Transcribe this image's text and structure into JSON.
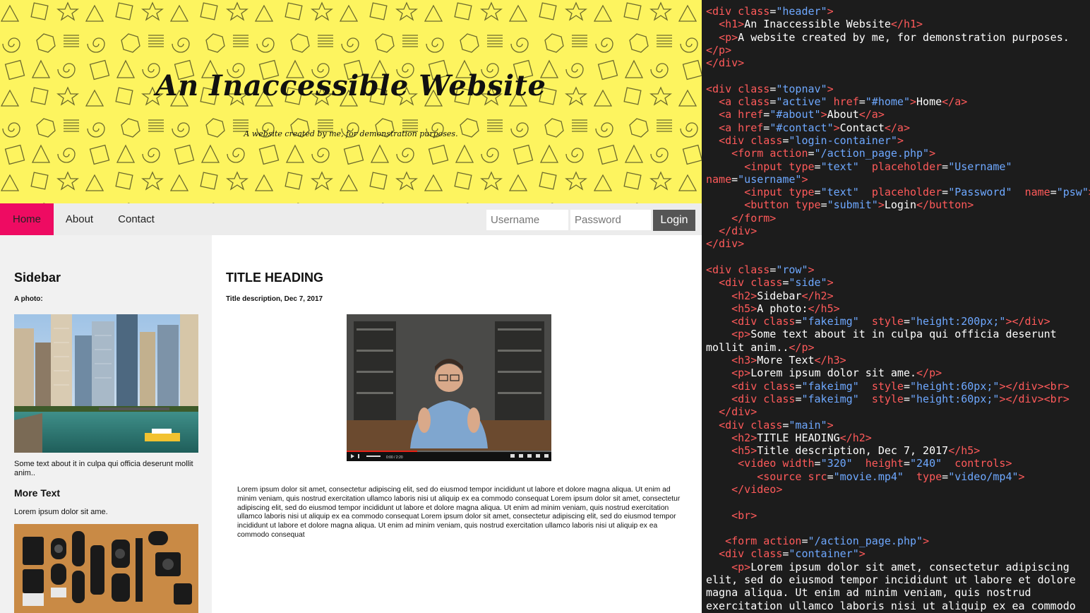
{
  "header": {
    "title": "An Inaccessible Website",
    "subtitle": "A website created by me, for demonstration purposes."
  },
  "topnav": {
    "home": "Home",
    "about": "About",
    "contact": "Contact",
    "username_placeholder": "Username",
    "password_placeholder": "Password",
    "login": "Login",
    "active_color": "#ee0b62"
  },
  "sidebar": {
    "heading": "Sidebar",
    "photo_label": "A photo:",
    "photo_text": "Some text about it in culpa qui officia deserunt mollit anim..",
    "more_heading": "More Text",
    "more_text": "Lorem ipsum dolor sit ame."
  },
  "main": {
    "heading": "TITLE HEADING",
    "description": "Title description, Dec 7, 2017",
    "video_time": "0:00 / 2:20",
    "body": "Lorem ipsum dolor sit amet, consectetur adipiscing elit, sed do eiusmod tempor incididunt ut labore et dolore magna aliqua. Ut enim ad minim veniam, quis nostrud exercitation ullamco laboris nisi ut aliquip ex ea commodo consequat Lorem ipsum dolor sit amet, consectetur adipiscing elit, sed do eiusmod tempor incididunt ut labore et dolore magna aliqua. Ut enim ad minim veniam, quis nostrud exercitation ullamco laboris nisi ut aliquip ex ea commodo consequat Lorem ipsum dolor sit amet, consectetur adipiscing elit, sed do eiusmod tempor incididunt ut labore et dolore magna aliqua. Ut enim ad minim veniam, quis nostrud exercitation ullamco laboris nisi ut aliquip ex ea commodo consequat"
  },
  "colors": {
    "header_bg": "#fdf45f",
    "code_bg": "#1c1c1c",
    "code_tag": "#ff5a5a",
    "code_value": "#6ea8ff"
  },
  "code_lines": [
    [
      [
        "t",
        "<div "
      ],
      [
        "a",
        "class"
      ],
      [
        "w",
        "="
      ],
      [
        "v",
        "\"header\""
      ],
      [
        "t",
        ">"
      ]
    ],
    [
      [
        "w",
        "  "
      ],
      [
        "t",
        "<h1>"
      ],
      [
        "w",
        "An Inaccessible Website"
      ],
      [
        "t",
        "</h1>"
      ]
    ],
    [
      [
        "w",
        "  "
      ],
      [
        "t",
        "<p>"
      ],
      [
        "w",
        "A website created by me, for demonstration purposes."
      ]
    ],
    [
      [
        "t",
        "</p>"
      ]
    ],
    [
      [
        "t",
        "</div>"
      ]
    ],
    [
      [
        "w",
        ""
      ]
    ],
    [
      [
        "t",
        "<div "
      ],
      [
        "a",
        "class"
      ],
      [
        "w",
        "="
      ],
      [
        "v",
        "\"topnav\""
      ],
      [
        "t",
        ">"
      ]
    ],
    [
      [
        "w",
        "  "
      ],
      [
        "t",
        "<a "
      ],
      [
        "a",
        "class"
      ],
      [
        "w",
        "="
      ],
      [
        "v",
        "\"active\""
      ],
      [
        "w",
        " "
      ],
      [
        "a",
        "href"
      ],
      [
        "w",
        "="
      ],
      [
        "v",
        "\"#home\""
      ],
      [
        "t",
        ">"
      ],
      [
        "w",
        "Home"
      ],
      [
        "t",
        "</a>"
      ]
    ],
    [
      [
        "w",
        "  "
      ],
      [
        "t",
        "<a "
      ],
      [
        "a",
        "href"
      ],
      [
        "w",
        "="
      ],
      [
        "v",
        "\"#about\""
      ],
      [
        "t",
        ">"
      ],
      [
        "w",
        "About"
      ],
      [
        "t",
        "</a>"
      ]
    ],
    [
      [
        "w",
        "  "
      ],
      [
        "t",
        "<a "
      ],
      [
        "a",
        "href"
      ],
      [
        "w",
        "="
      ],
      [
        "v",
        "\"#contact\""
      ],
      [
        "t",
        ">"
      ],
      [
        "w",
        "Contact"
      ],
      [
        "t",
        "</a>"
      ]
    ],
    [
      [
        "w",
        "  "
      ],
      [
        "t",
        "<div "
      ],
      [
        "a",
        "class"
      ],
      [
        "w",
        "="
      ],
      [
        "v",
        "\"login-container\""
      ],
      [
        "t",
        ">"
      ]
    ],
    [
      [
        "w",
        "    "
      ],
      [
        "t",
        "<form "
      ],
      [
        "a",
        "action"
      ],
      [
        "w",
        "="
      ],
      [
        "v",
        "\"/action_page.php\""
      ],
      [
        "t",
        ">"
      ]
    ],
    [
      [
        "w",
        "      "
      ],
      [
        "t",
        "<input "
      ],
      [
        "a",
        "type"
      ],
      [
        "w",
        "="
      ],
      [
        "v",
        "\"text\""
      ],
      [
        "w",
        "  "
      ],
      [
        "a",
        "placeholder"
      ],
      [
        "w",
        "="
      ],
      [
        "v",
        "\"Username\""
      ]
    ],
    [
      [
        "a",
        "name"
      ],
      [
        "w",
        "="
      ],
      [
        "v",
        "\"username\""
      ],
      [
        "t",
        ">"
      ]
    ],
    [
      [
        "w",
        "      "
      ],
      [
        "t",
        "<input "
      ],
      [
        "a",
        "type"
      ],
      [
        "w",
        "="
      ],
      [
        "v",
        "\"text\""
      ],
      [
        "w",
        "  "
      ],
      [
        "a",
        "placeholder"
      ],
      [
        "w",
        "="
      ],
      [
        "v",
        "\"Password\""
      ],
      [
        "w",
        "  "
      ],
      [
        "a",
        "name"
      ],
      [
        "w",
        "="
      ],
      [
        "v",
        "\"psw\""
      ],
      [
        "t",
        ">"
      ]
    ],
    [
      [
        "w",
        "      "
      ],
      [
        "t",
        "<button "
      ],
      [
        "a",
        "type"
      ],
      [
        "w",
        "="
      ],
      [
        "v",
        "\"submit\""
      ],
      [
        "t",
        ">"
      ],
      [
        "w",
        "Login"
      ],
      [
        "t",
        "</button>"
      ]
    ],
    [
      [
        "w",
        "    "
      ],
      [
        "t",
        "</form>"
      ]
    ],
    [
      [
        "w",
        "  "
      ],
      [
        "t",
        "</div>"
      ]
    ],
    [
      [
        "t",
        "</div>"
      ]
    ],
    [
      [
        "w",
        ""
      ]
    ],
    [
      [
        "t",
        "<div "
      ],
      [
        "a",
        "class"
      ],
      [
        "w",
        "="
      ],
      [
        "v",
        "\"row\""
      ],
      [
        "t",
        ">"
      ]
    ],
    [
      [
        "w",
        "  "
      ],
      [
        "t",
        "<div "
      ],
      [
        "a",
        "class"
      ],
      [
        "w",
        "="
      ],
      [
        "v",
        "\"side\""
      ],
      [
        "t",
        ">"
      ]
    ],
    [
      [
        "w",
        "    "
      ],
      [
        "t",
        "<h2>"
      ],
      [
        "w",
        "Sidebar"
      ],
      [
        "t",
        "</h2>"
      ]
    ],
    [
      [
        "w",
        "    "
      ],
      [
        "t",
        "<h5>"
      ],
      [
        "w",
        "A photo:"
      ],
      [
        "t",
        "</h5>"
      ]
    ],
    [
      [
        "w",
        "    "
      ],
      [
        "t",
        "<div "
      ],
      [
        "a",
        "class"
      ],
      [
        "w",
        "="
      ],
      [
        "v",
        "\"fakeimg\""
      ],
      [
        "w",
        "  "
      ],
      [
        "a",
        "style"
      ],
      [
        "w",
        "="
      ],
      [
        "v",
        "\"height:200px;\""
      ],
      [
        "t",
        "></div>"
      ]
    ],
    [
      [
        "w",
        "    "
      ],
      [
        "t",
        "<p>"
      ],
      [
        "w",
        "Some text about it in culpa qui officia deserunt"
      ]
    ],
    [
      [
        "w",
        "mollit anim.."
      ],
      [
        "t",
        "</p>"
      ]
    ],
    [
      [
        "w",
        "    "
      ],
      [
        "t",
        "<h3>"
      ],
      [
        "w",
        "More Text"
      ],
      [
        "t",
        "</h3>"
      ]
    ],
    [
      [
        "w",
        "    "
      ],
      [
        "t",
        "<p>"
      ],
      [
        "w",
        "Lorem ipsum dolor sit ame."
      ],
      [
        "t",
        "</p>"
      ]
    ],
    [
      [
        "w",
        "    "
      ],
      [
        "t",
        "<div "
      ],
      [
        "a",
        "class"
      ],
      [
        "w",
        "="
      ],
      [
        "v",
        "\"fakeimg\""
      ],
      [
        "w",
        "  "
      ],
      [
        "a",
        "style"
      ],
      [
        "w",
        "="
      ],
      [
        "v",
        "\"height:60px;\""
      ],
      [
        "t",
        "></div><br>"
      ]
    ],
    [
      [
        "w",
        "    "
      ],
      [
        "t",
        "<div "
      ],
      [
        "a",
        "class"
      ],
      [
        "w",
        "="
      ],
      [
        "v",
        "\"fakeimg\""
      ],
      [
        "w",
        "  "
      ],
      [
        "a",
        "style"
      ],
      [
        "w",
        "="
      ],
      [
        "v",
        "\"height:60px;\""
      ],
      [
        "t",
        "></div><br>"
      ]
    ],
    [
      [
        "w",
        "  "
      ],
      [
        "t",
        "</div>"
      ]
    ],
    [
      [
        "w",
        "  "
      ],
      [
        "t",
        "<div "
      ],
      [
        "a",
        "class"
      ],
      [
        "w",
        "="
      ],
      [
        "v",
        "\"main\""
      ],
      [
        "t",
        ">"
      ]
    ],
    [
      [
        "w",
        "    "
      ],
      [
        "t",
        "<h2>"
      ],
      [
        "w",
        "TITLE HEADING"
      ],
      [
        "t",
        "</h2>"
      ]
    ],
    [
      [
        "w",
        "    "
      ],
      [
        "t",
        "<h5>"
      ],
      [
        "w",
        "Title description, Dec 7, 2017"
      ],
      [
        "t",
        "</h5>"
      ]
    ],
    [
      [
        "w",
        "     "
      ],
      [
        "t",
        "<video "
      ],
      [
        "a",
        "width"
      ],
      [
        "w",
        "="
      ],
      [
        "v",
        "\"320\""
      ],
      [
        "w",
        "  "
      ],
      [
        "a",
        "height"
      ],
      [
        "w",
        "="
      ],
      [
        "v",
        "\"240\""
      ],
      [
        "w",
        "  "
      ],
      [
        "a",
        "controls"
      ],
      [
        "t",
        ">"
      ]
    ],
    [
      [
        "w",
        "        "
      ],
      [
        "t",
        "<source "
      ],
      [
        "a",
        "src"
      ],
      [
        "w",
        "="
      ],
      [
        "v",
        "\"movie.mp4\""
      ],
      [
        "w",
        "  "
      ],
      [
        "a",
        "type"
      ],
      [
        "w",
        "="
      ],
      [
        "v",
        "\"video/mp4\""
      ],
      [
        "t",
        ">"
      ]
    ],
    [
      [
        "w",
        "    "
      ],
      [
        "t",
        "</video>"
      ]
    ],
    [
      [
        "w",
        ""
      ]
    ],
    [
      [
        "w",
        "    "
      ],
      [
        "t",
        "<br>"
      ]
    ],
    [
      [
        "w",
        ""
      ]
    ],
    [
      [
        "w",
        "   "
      ],
      [
        "t",
        "<form "
      ],
      [
        "a",
        "action"
      ],
      [
        "w",
        "="
      ],
      [
        "v",
        "\"/action_page.php\""
      ],
      [
        "t",
        ">"
      ]
    ],
    [
      [
        "w",
        "  "
      ],
      [
        "t",
        "<div "
      ],
      [
        "a",
        "class"
      ],
      [
        "w",
        "="
      ],
      [
        "v",
        "\"container\""
      ],
      [
        "t",
        ">"
      ]
    ],
    [
      [
        "w",
        "    "
      ],
      [
        "t",
        "<p>"
      ],
      [
        "w",
        "Lorem ipsum dolor sit amet, consectetur adipiscing"
      ]
    ],
    [
      [
        "w",
        "elit, sed do eiusmod tempor incididunt ut labore et dolore"
      ]
    ],
    [
      [
        "w",
        "magna aliqua. Ut enim ad minim veniam, quis nostrud"
      ]
    ],
    [
      [
        "w",
        "exercitation ullamco laboris nisi ut aliquip ex ea commodo"
      ]
    ]
  ]
}
